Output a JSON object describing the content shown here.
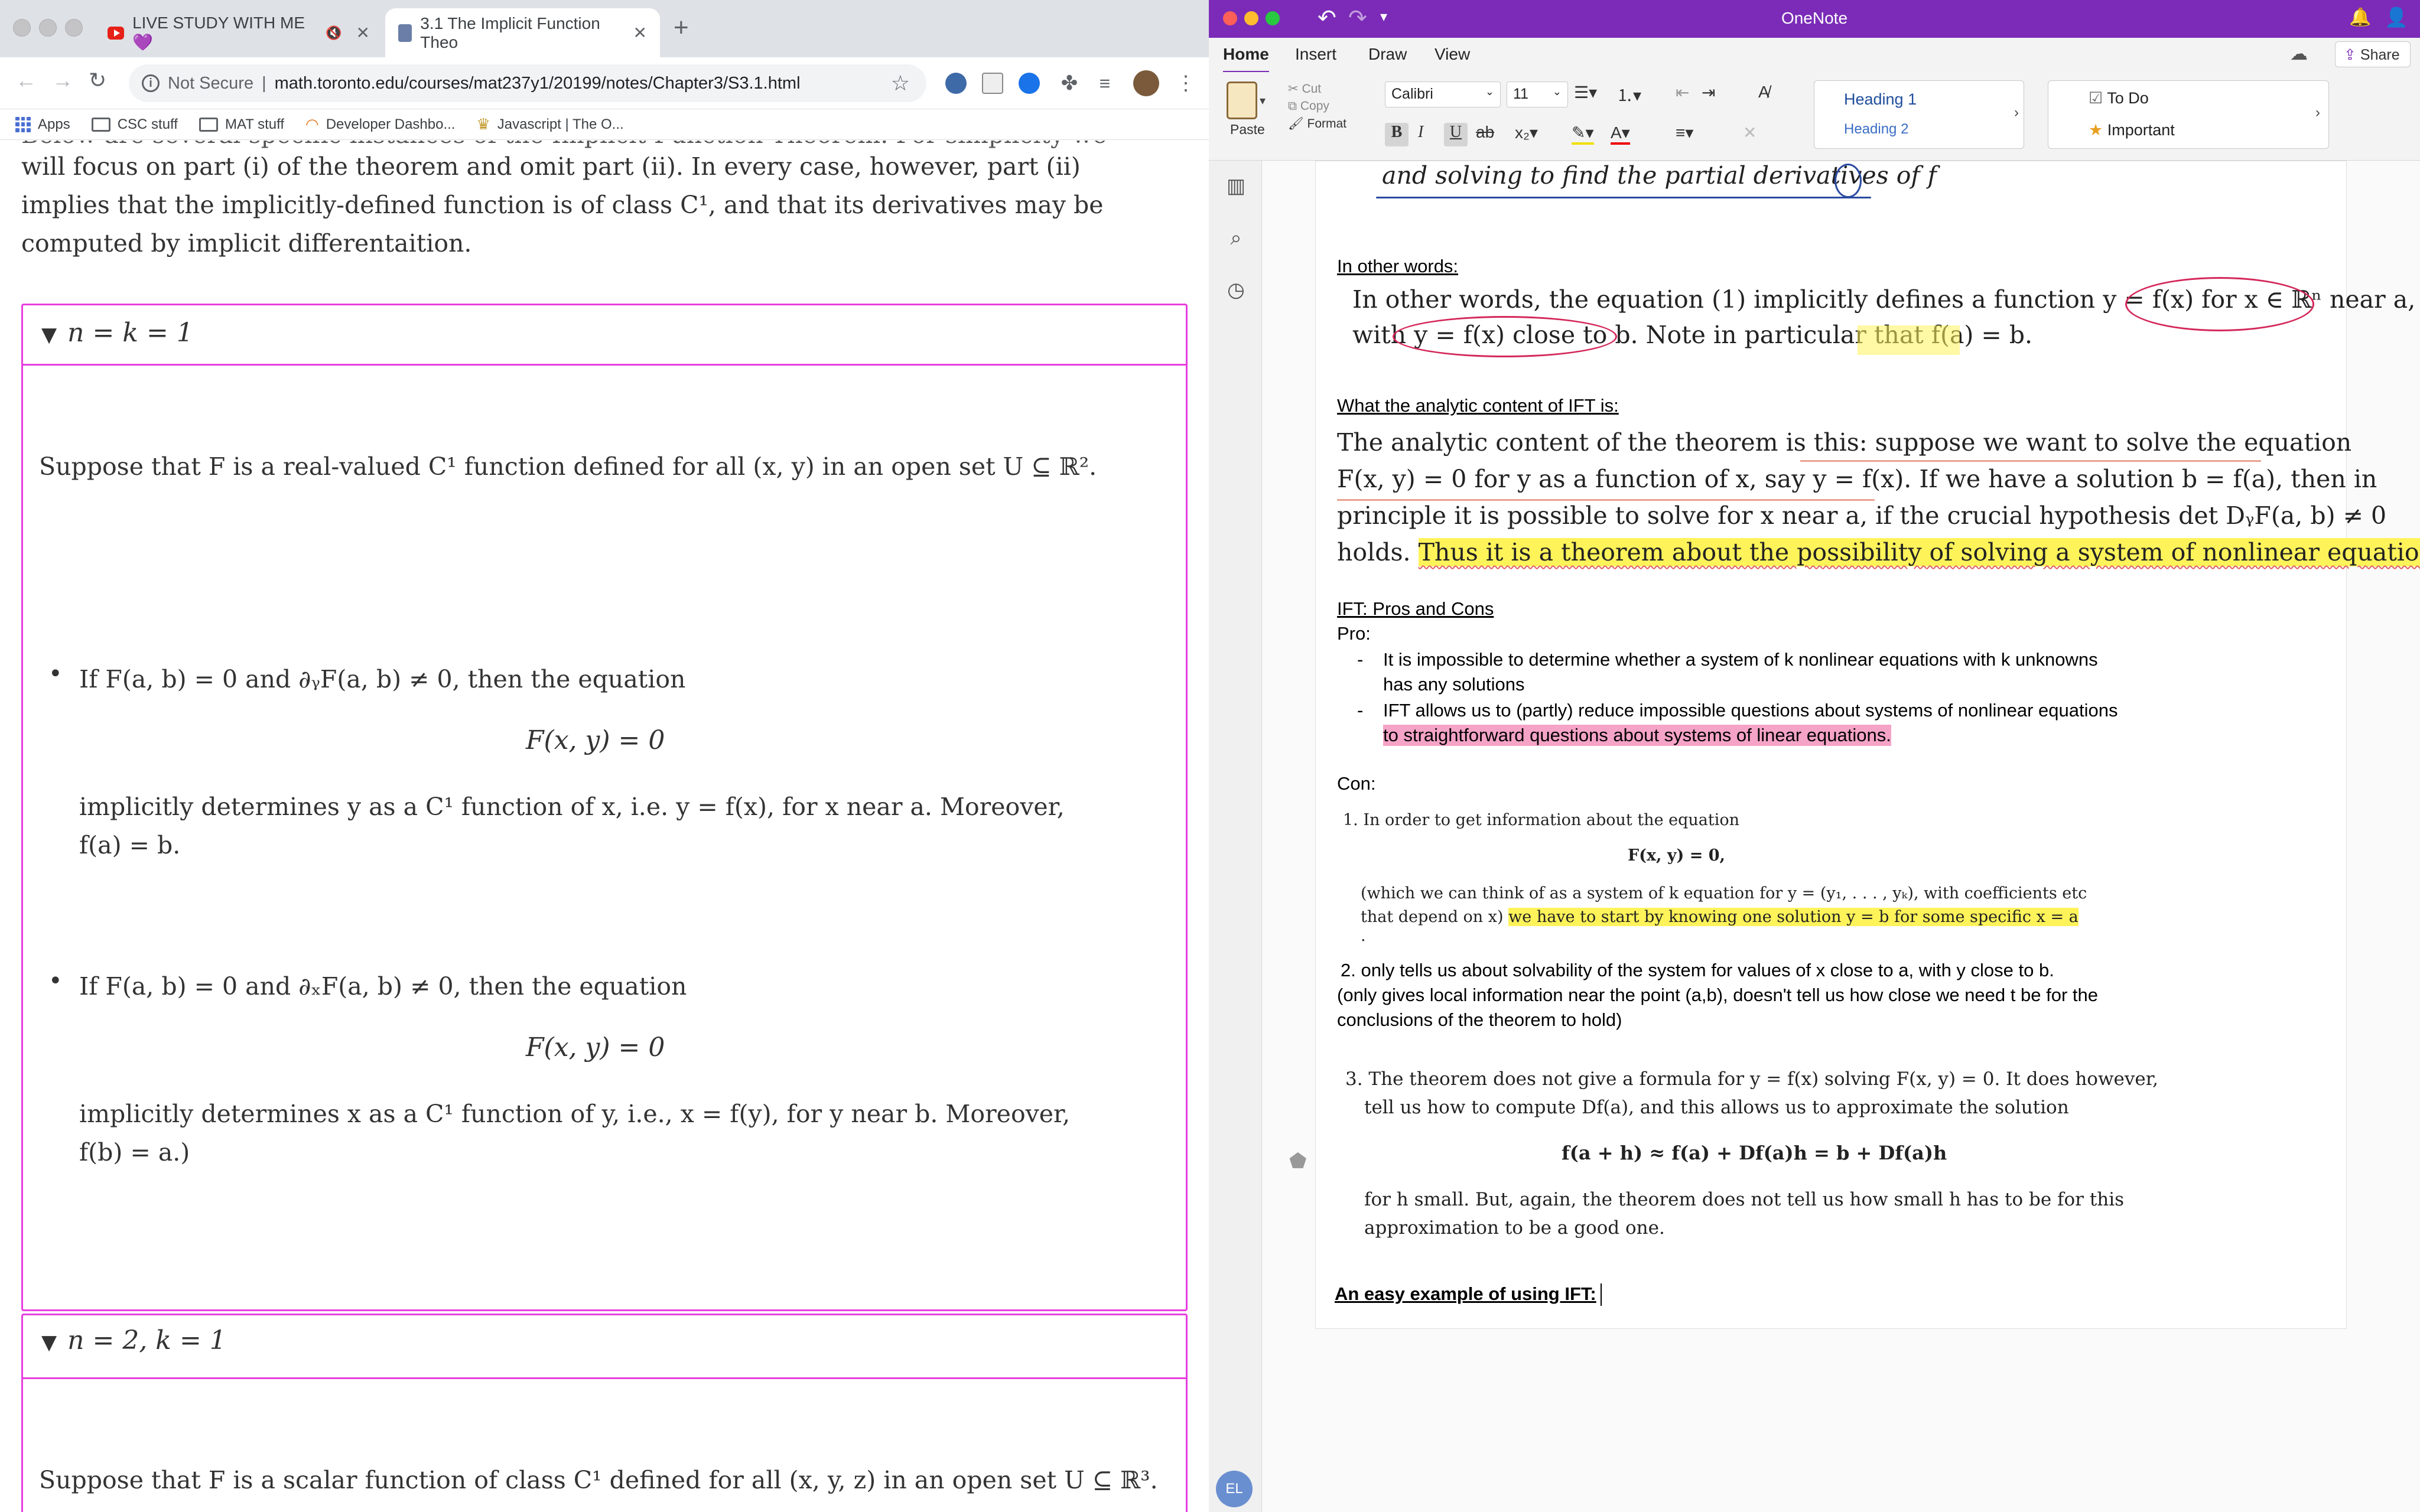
{
  "browser": {
    "tabs": [
      {
        "title": "LIVE STUDY WITH ME 💜",
        "icon": "youtube-icon",
        "audio": "🔇"
      },
      {
        "title": "3.1 The Implicit Function Theo",
        "icon": "university-icon"
      }
    ],
    "omnibox": {
      "security": "Not Secure",
      "url": "math.toronto.edu/courses/mat237y1/20199/notes/Chapter3/S3.1.html"
    },
    "bookmarks": [
      "Apps",
      "CSC stuff",
      "MAT stuff",
      "Developer Dashbo...",
      "Javascript | The O..."
    ],
    "page": {
      "intro_top": "Below are several specific instances of the Implicit Function Theorem. For simplicity we",
      "intro_line1": "will focus on part (i) of the theorem and omit part (ii). In every case, however, part (ii)",
      "intro_line2": "implies that the implicitly-defined function is of class C¹, and that its derivatives may be",
      "intro_line3": "computed by implicit differentaition.",
      "section1": {
        "header": "n = k = 1",
        "suppose": "Suppose that F is a real-valued C¹ function defined for all (x, y) in an open set U ⊆ ℝ².",
        "bullet1_cond": "If F(a, b) = 0 and ∂ᵧF(a, b) ≠ 0, then the equation",
        "bullet1_eq": "F(x, y) = 0",
        "bullet1_res1": "implicitly determines y as a C¹ function of x, i.e. y = f(x), for x near a. Moreover,",
        "bullet1_res2": "f(a) = b.",
        "bullet2_cond": "If F(a, b) = 0 and ∂ₓF(a, b) ≠ 0, then the equation",
        "bullet2_eq": "F(x, y) = 0",
        "bullet2_res1": "implicitly determines x as a C¹ function of y, i.e., x = f(y), for y near b. Moreover,",
        "bullet2_res2": "f(b) = a.)"
      },
      "section2": {
        "header": "n = 2, k = 1",
        "suppose": "Suppose that F is a scalar function of class C¹ defined for all (x, y, z) in an open set U ⊆ ℝ³."
      }
    }
  },
  "onenote": {
    "title": "OneNote",
    "share": "Share",
    "tabs": [
      "Home",
      "Insert",
      "Draw",
      "View"
    ],
    "clipboard": {
      "paste": "Paste",
      "cut": "Cut",
      "copy": "Copy",
      "format": "Format"
    },
    "font": {
      "family": "Calibri",
      "size": "11"
    },
    "styles": [
      "Heading 1",
      "Heading 2"
    ],
    "tags": [
      "To Do",
      "Important"
    ],
    "avatar": "EL",
    "note": {
      "top_line": "and solving to find the partial derivatives of f",
      "h_other": "In other words:",
      "ow_line1": "In other words, the equation (1) implicitly defines a function y = f(x) for x ∈ ℝⁿ near a,",
      "ow_line2": "with y = f(x) close to b. Note in particular that f(a) = b.",
      "h_analytic": "What the analytic content of IFT is:",
      "an_line1": "The analytic content of the theorem is this: suppose we want to solve the equation",
      "an_line2": "F(x, y) = 0 for y as a function of x, say y = f(x). If we have a solution b = f(a), then in",
      "an_line3": "principle it is possible to solve for x near a, if the crucial hypothesis det DᵧF(a, b) ≠ 0",
      "an_line4a": "holds.",
      "an_line4b": "Thus it is a theorem about the possibility of solving a system of nonlinear equations.",
      "h_pros": "IFT: Pros and Cons",
      "pro_label": "Pro:",
      "pro1a": "It is impossible to determine whether a system of k nonlinear equations with k unknowns",
      "pro1b": "has any solutions",
      "pro2a": "IFT allows us to (partly) reduce impossible questions about systems of nonlinear equations",
      "pro2b": "to straightforward questions about systems of linear equations.",
      "con_label": "Con:",
      "con1": "1. In order to get information about the equation",
      "con1_eq": "F(x, y) = 0,",
      "con1_b": "(which we can think of as a system of k equation for y = (y₁, . . . , yₖ), with coefficients etc",
      "con1_c": "that depend on x)",
      "con1_d": "we have to start by knowing one solution y = b for some specific x = a",
      "con1_dot": ".",
      "con2a": "2. only tells us about solvability of the system for values of x close to a, with y close to b.",
      "con2b": "(only gives local information near the point (a,b), doesn't tell us how close we need t be for the",
      "con2c": "conclusions of the theorem to hold)",
      "con3a": "3. The theorem does not give a formula for y = f(x) solving F(x, y) = 0. It does however,",
      "con3b": "tell us how to compute Df(a), and this allows us to approximate the solution",
      "con3_eq": "f(a + h) ≈ f(a) + Df(a)h = b + Df(a)h",
      "con3c": "for h small. But, again, the theorem does not tell us how small h has to be for this",
      "con3d": "approximation to be a good one.",
      "easy": "An easy example of using IFT:"
    }
  }
}
